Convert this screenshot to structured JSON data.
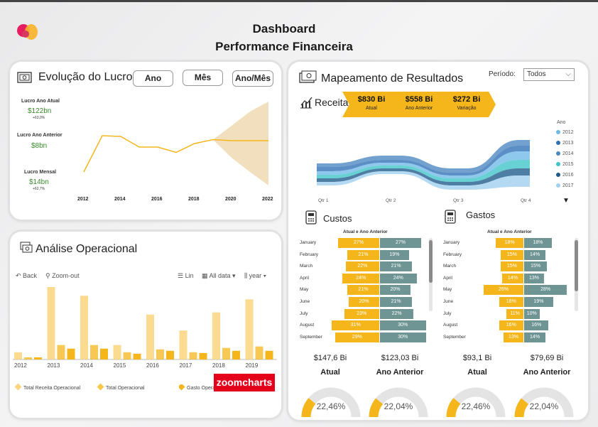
{
  "title": {
    "line1": "Dashboard",
    "line2": "Performance Financeira"
  },
  "colors": {
    "accent": "#f5b61c",
    "gray_bar": "#6e9494",
    "green": "#3a8a2c",
    "fan": "#f1dfbd",
    "op_light": "#fad57b",
    "op_dark": "#f5b61c",
    "zoom_red": "#e4001b"
  },
  "lucro": {
    "title": "Evolução do Lucro",
    "buttons": [
      "Ano",
      "Mês",
      "Ano/Mês"
    ],
    "kpis": [
      {
        "label": "Lucro Ano Atual",
        "value": "$122bn",
        "sub": "+63,0%"
      },
      {
        "label": "Lucro Ano Anterior",
        "value": "$8bn",
        "sub": ""
      },
      {
        "label": "Lucro Mensal",
        "value": "$14bn",
        "sub": "+62,7%"
      }
    ]
  },
  "operacional": {
    "title": "Análise Operacional",
    "toolbar": {
      "back": "Back",
      "zoom_out": "Zoom-out",
      "lin": "Lin",
      "all_data": "All data",
      "year": "year"
    },
    "legend": [
      "Total Receita Operacional",
      "Total Operacional",
      "Gasto Operacional"
    ],
    "brand": "zoomcharts"
  },
  "mapeamento": {
    "title": "Mapeamento de Resultados",
    "periodo_label": "Período:",
    "periodo_value": "Todos",
    "receita_label": "Receita",
    "arrows": [
      {
        "value": "$830 Bi",
        "label": "Atual"
      },
      {
        "value": "$558 Bi",
        "label": "Ano Anterior"
      },
      {
        "value": "$272 Bi",
        "label": "Variação"
      }
    ],
    "legend_title": "Ano",
    "custos": {
      "title": "Custos",
      "subtitle": "Atual e Ano Anterior",
      "atual_value": "$147,6 Bi",
      "anterior_value": "$123,03 Bi",
      "atual_label": "Atual",
      "anterior_label": "Ano Anterior",
      "gauge1": "22,46%",
      "gauge2": "22,04%"
    },
    "gastos": {
      "title": "Gastos",
      "subtitle": "Atual e Ano Anterior",
      "atual_value": "$93,1 Bi",
      "anterior_value": "$79,69 Bi",
      "atual_label": "Atual",
      "anterior_label": "Ano Anterior",
      "gauge1": "22,46%",
      "gauge2": "22,04%"
    }
  },
  "chart_data": [
    {
      "type": "line",
      "x": [
        2012,
        2013,
        2014,
        2015,
        2016,
        2017,
        2018,
        2019,
        2020,
        2021,
        2022
      ],
      "y": [
        -80,
        22,
        20,
        -10,
        -10,
        -25,
        0,
        11,
        8,
        8,
        8
      ],
      "xlabel": "",
      "ylabel": "",
      "xticks": [
        "2012",
        "2014",
        "2016",
        "2018",
        "2020",
        "2022"
      ],
      "forecast_from": 2019,
      "forecast_upper": [
        11,
        50,
        90,
        118
      ],
      "forecast_lower": [
        11,
        -40,
        -80,
        -118
      ],
      "grid": false
    },
    {
      "type": "bar",
      "categories": [
        "2012",
        "2013",
        "2014",
        "2015",
        "2016",
        "2017",
        "2018",
        "2019"
      ],
      "series": [
        {
          "name": "Total Receita Operacional",
          "values": [
            10,
            100,
            88,
            20,
            62,
            40,
            65,
            83
          ]
        },
        {
          "name": "Total Operacional",
          "values": [
            3,
            20,
            20,
            10,
            14,
            10,
            16,
            18
          ]
        },
        {
          "name": "Gasto Operacional",
          "values": [
            3,
            15,
            15,
            8,
            12,
            9,
            12,
            12
          ]
        }
      ]
    },
    {
      "type": "area",
      "categories": [
        "Qtr 1",
        "Qtr 2",
        "Qtr 3",
        "Qtr 4"
      ],
      "series": [
        {
          "name": "2012",
          "color": "#6fb9e8"
        },
        {
          "name": "2013",
          "color": "#2e6fb5"
        },
        {
          "name": "2014",
          "color": "#4b87c2"
        },
        {
          "name": "2015",
          "color": "#3cc4c8"
        },
        {
          "name": "2016",
          "color": "#1d5a8a"
        },
        {
          "name": "2017",
          "color": "#9fd0ef"
        }
      ]
    },
    {
      "type": "bar",
      "title": "Custos",
      "categories": [
        "January",
        "February",
        "March",
        "April",
        "May",
        "June",
        "July",
        "August",
        "September"
      ],
      "series": [
        {
          "name": "Atual",
          "values": [
            27,
            21,
            22,
            24,
            21,
            20,
            23,
            31,
            29
          ]
        },
        {
          "name": "Ano Anterior",
          "values": [
            27,
            19,
            21,
            24,
            20,
            21,
            22,
            30,
            30
          ]
        }
      ]
    },
    {
      "type": "bar",
      "title": "Gastos",
      "categories": [
        "January",
        "February",
        "March",
        "April",
        "May",
        "June",
        "July",
        "August",
        "September"
      ],
      "series": [
        {
          "name": "Atual",
          "values": [
            18,
            15,
            15,
            14,
            26,
            16,
            11,
            16,
            13
          ]
        },
        {
          "name": "Ano Anterior",
          "values": [
            18,
            14,
            15,
            13,
            28,
            19,
            10,
            16,
            14
          ]
        }
      ]
    }
  ]
}
